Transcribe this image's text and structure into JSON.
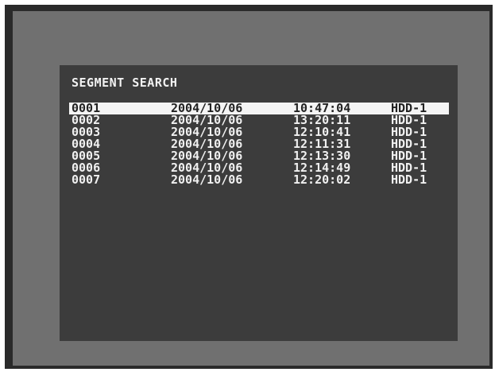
{
  "title": "SEGMENT SEARCH",
  "segments": [
    {
      "id": "0001",
      "date": "2004/10/06",
      "time": "10:47:04",
      "device": "HDD-1",
      "selected": true
    },
    {
      "id": "0002",
      "date": "2004/10/06",
      "time": "13:20:11",
      "device": "HDD-1",
      "selected": false
    },
    {
      "id": "0003",
      "date": "2004/10/06",
      "time": "12:10:41",
      "device": "HDD-1",
      "selected": false
    },
    {
      "id": "0004",
      "date": "2004/10/06",
      "time": "12:11:31",
      "device": "HDD-1",
      "selected": false
    },
    {
      "id": "0005",
      "date": "2004/10/06",
      "time": "12:13:30",
      "device": "HDD-1",
      "selected": false
    },
    {
      "id": "0006",
      "date": "2004/10/06",
      "time": "12:14:49",
      "device": "HDD-1",
      "selected": false
    },
    {
      "id": "0007",
      "date": "2004/10/06",
      "time": "12:20:02",
      "device": "HDD-1",
      "selected": false
    }
  ],
  "colors": {
    "screen": "#3c3c3c",
    "bezel": "#707070",
    "text": "#f0f0f0",
    "highlight": "#f4f4f4"
  }
}
